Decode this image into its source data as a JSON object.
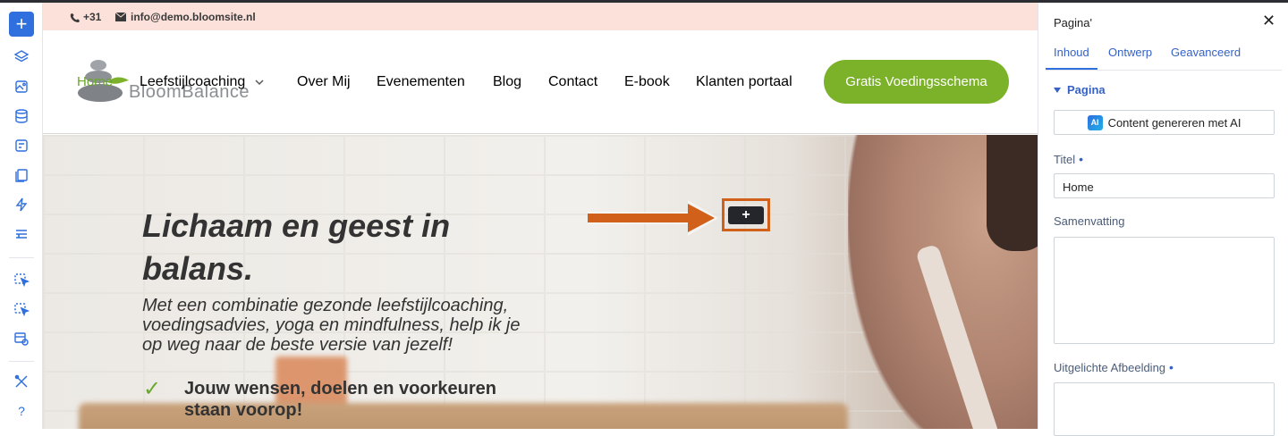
{
  "colors": {
    "accent": "#2f6fde",
    "brand_green": "#7cb22a",
    "annotation": "#d0601a"
  },
  "toolbar": {
    "items": [
      {
        "name": "add-icon",
        "glyph": "+"
      },
      {
        "name": "layers-icon"
      },
      {
        "name": "media-icon"
      },
      {
        "name": "database-icon"
      },
      {
        "name": "form-icon"
      },
      {
        "name": "pages-icon"
      },
      {
        "name": "lightning-icon"
      },
      {
        "name": "table-icon"
      },
      {
        "name": "click-edit-icon"
      },
      {
        "name": "click-select-icon"
      },
      {
        "name": "preview-icon"
      },
      {
        "name": "tools-icon"
      },
      {
        "name": "help-icon",
        "glyph": "?"
      }
    ]
  },
  "site": {
    "phone": "+31",
    "email": "info@demo.bloomsite.nl",
    "logo_text": "BloomBalance",
    "nav": {
      "home": "Home",
      "items": [
        "Leefstijlcoaching",
        "Over Mij",
        "Evenementen",
        "Blog",
        "Contact",
        "E-book",
        "Klanten portaal"
      ]
    },
    "cta": "Gratis Voedingsschema",
    "hero": {
      "title": "Lichaam en geest in balans.",
      "subtitle": "Met een combinatie gezonde leefstijlcoaching, voedingsadvies, yoga en mindfulness, help ik je op weg naar de beste versie van jezelf!",
      "check_glyph": "✓",
      "point": "Jouw wensen, doelen en voorkeuren staan voorop!"
    },
    "add_block_glyph": "+"
  },
  "panel": {
    "title": "Pagina'",
    "close_glyph": "✕",
    "tabs": [
      "Inhoud",
      "Ontwerp",
      "Geavanceerd"
    ],
    "section": "Pagina",
    "ai_badge": "AI",
    "ai_button": "Content genereren met AI",
    "fields": {
      "title_label": "Titel",
      "title_value": "Home",
      "summary_label": "Samenvatting",
      "image_label": "Uitgelichte Afbeelding"
    }
  }
}
